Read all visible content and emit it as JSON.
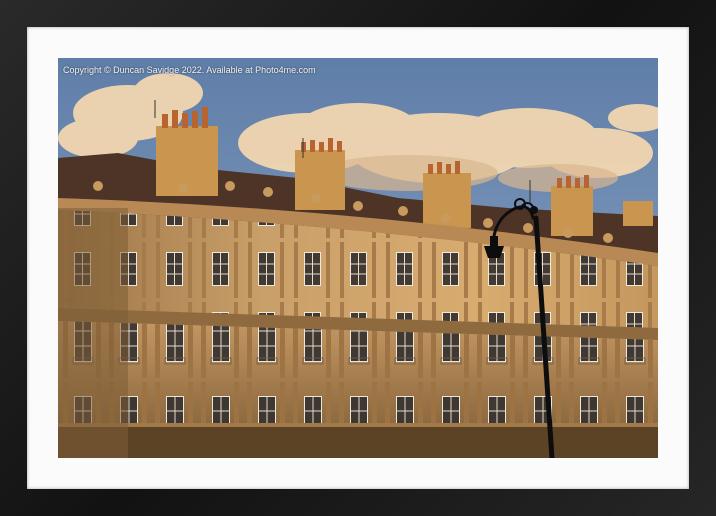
{
  "copyright": "Copyright © Duncan Savidge 2022. Available at Photo4me.com",
  "colors": {
    "frame": "#1a1a1a",
    "mat": "#fbfbfb",
    "sky": "#6f8bb0",
    "cloud": "#f3d9b6",
    "stone_lit": "#d9a35a",
    "stone_shade": "#7a5a34",
    "roof": "#5a3a2a",
    "lamp": "#111111"
  }
}
